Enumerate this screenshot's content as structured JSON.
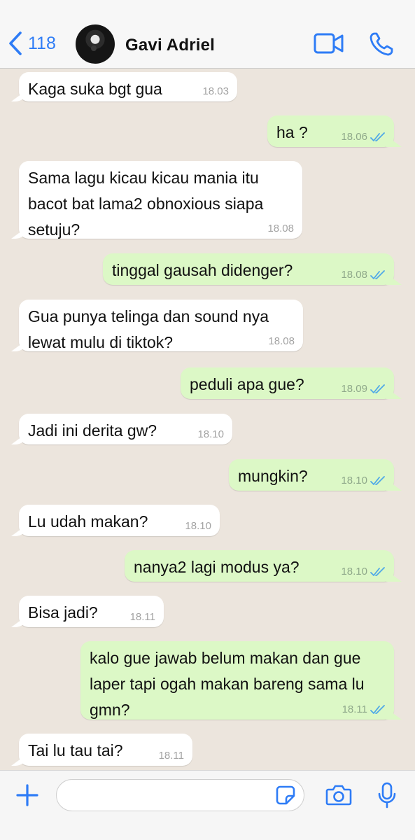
{
  "header": {
    "back_count": "118",
    "contact_name": "Gavi Adriel",
    "avatar_icon": "contact-avatar",
    "video_icon": "video-camera-icon",
    "call_icon": "phone-icon"
  },
  "colors": {
    "accent": "#2e7cf6",
    "incoming_bubble": "#ffffff",
    "outgoing_bubble": "#dcf8c6",
    "chat_background": "#ece5dd",
    "read_ticks": "#4fa8e8"
  },
  "messages": [
    {
      "dir": "in",
      "text": "Kaga suka bgt gua",
      "time": "18.03"
    },
    {
      "dir": "out",
      "text": "ha ?",
      "time": "18.06",
      "status": "read"
    },
    {
      "dir": "in",
      "text": "Sama lagu kicau kicau mania itu bacot bat lama2 obnoxious siapa setuju?",
      "time": "18.08"
    },
    {
      "dir": "out",
      "text": "tinggal gausah didenger?",
      "time": "18.08",
      "status": "read"
    },
    {
      "dir": "in",
      "text": "Gua punya telinga dan sound nya lewat mulu di tiktok?",
      "time": "18.08"
    },
    {
      "dir": "out",
      "text": "peduli apa gue?",
      "time": "18.09",
      "status": "read"
    },
    {
      "dir": "in",
      "text": "Jadi ini derita gw?",
      "time": "18.10"
    },
    {
      "dir": "out",
      "text": "mungkin?",
      "time": "18.10",
      "status": "read"
    },
    {
      "dir": "in",
      "text": "Lu udah makan?",
      "time": "18.10"
    },
    {
      "dir": "out",
      "text": "nanya2 lagi modus ya?",
      "time": "18.10",
      "status": "read"
    },
    {
      "dir": "in",
      "text": "Bisa jadi?",
      "time": "18.11"
    },
    {
      "dir": "out",
      "text": "kalo gue jawab belum makan dan gue laper tapi ogah makan bareng sama lu gmn?",
      "time": "18.11",
      "status": "read"
    },
    {
      "dir": "in",
      "text": "Tai lu tau tai?",
      "time": "18.11"
    }
  ],
  "input_bar": {
    "value": "",
    "plus_icon": "plus-icon",
    "sticker_icon": "sticker-icon",
    "camera_icon": "camera-icon",
    "mic_icon": "microphone-icon"
  }
}
